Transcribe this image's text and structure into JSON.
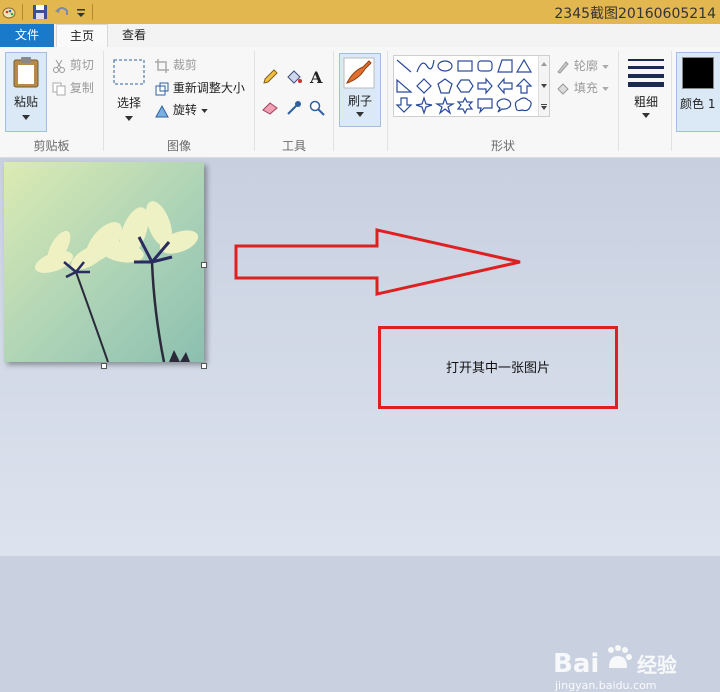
{
  "window": {
    "title": "2345截图20160605214"
  },
  "tabs": {
    "file": "文件",
    "home": "主页",
    "view": "查看"
  },
  "clipboard": {
    "paste": "粘贴",
    "cut": "剪切",
    "copy": "复制",
    "label": "剪贴板"
  },
  "image": {
    "select": "选择",
    "crop": "裁剪",
    "resize": "重新调整大小",
    "rotate": "旋转",
    "label": "图像"
  },
  "tools": {
    "label": "工具"
  },
  "brushes": {
    "label": "刷子"
  },
  "shapes": {
    "outline": "轮廓",
    "fill": "填充",
    "label": "形状"
  },
  "size": {
    "label": "粗细"
  },
  "color1": {
    "label": "颜色 1",
    "value": "#000000"
  },
  "annotation": {
    "text": "打开其中一张图片"
  },
  "watermark": {
    "brand": "Bai",
    "brand2": "经验",
    "url": "jingyan.baidu.com"
  },
  "colors": {
    "accent": "#1979ca",
    "titlebar": "#e2b74f",
    "annotation": "#e02020"
  }
}
